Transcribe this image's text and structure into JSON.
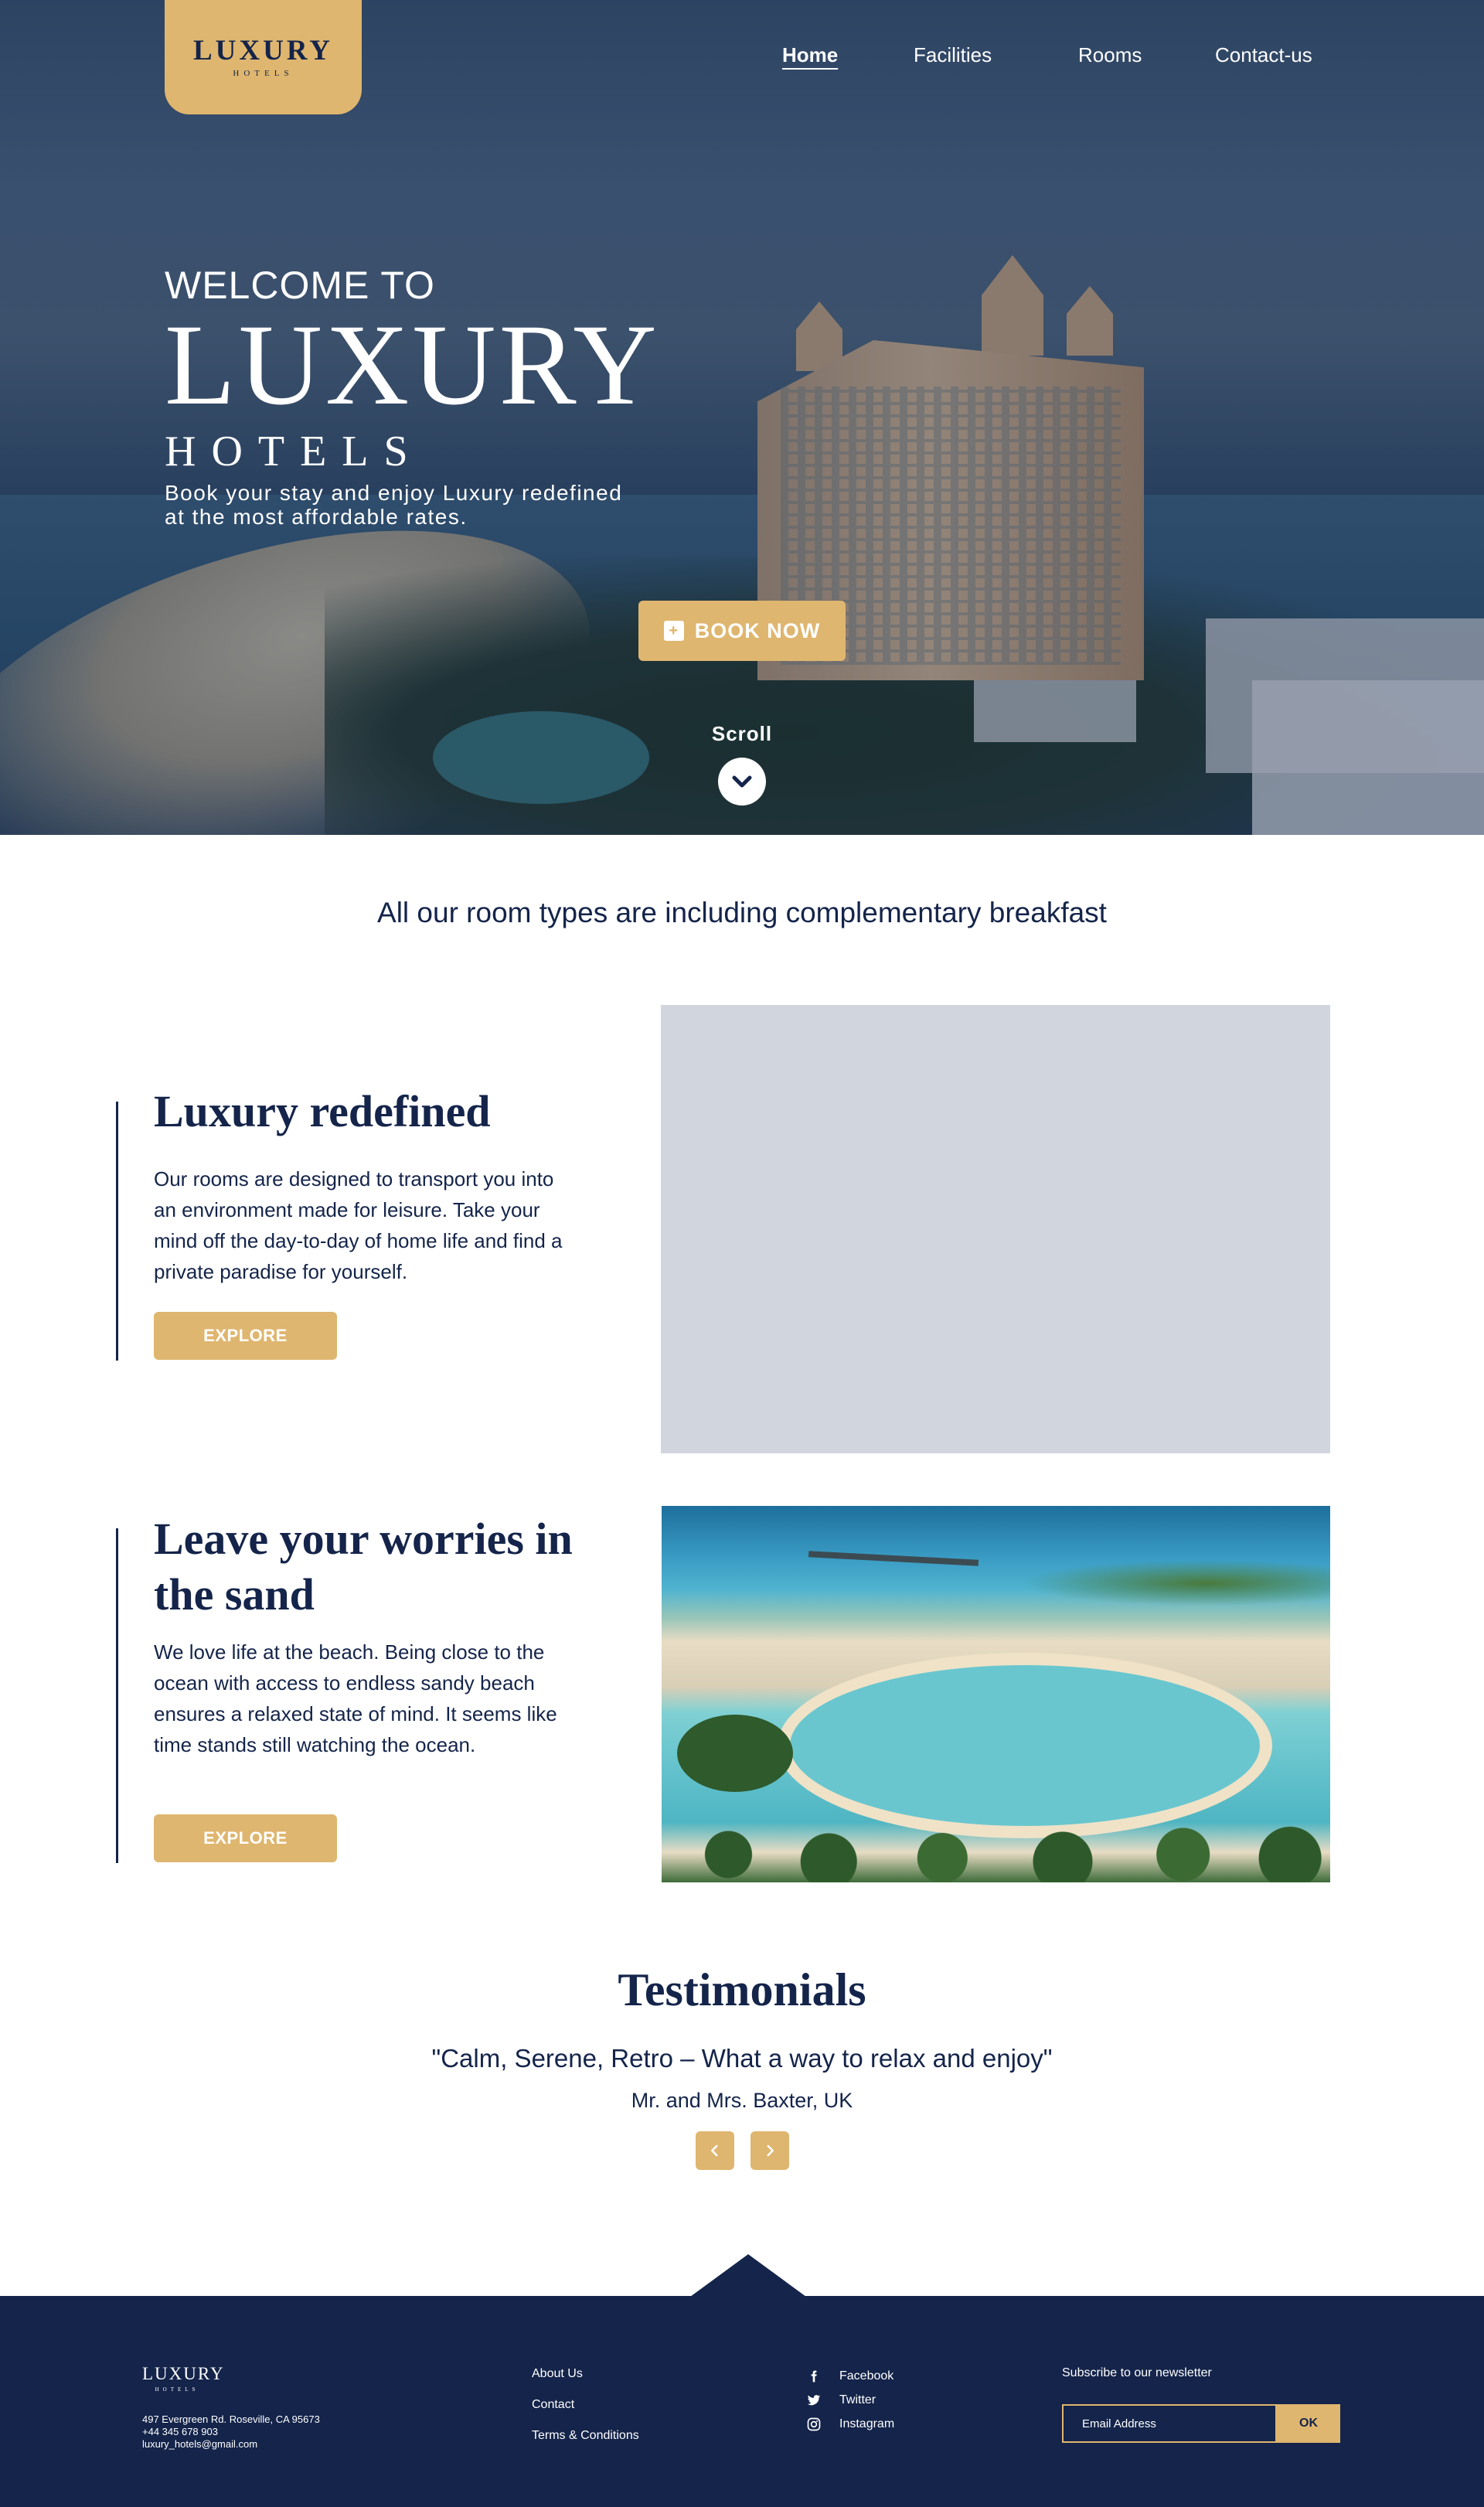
{
  "brand": {
    "name": "LUXURY",
    "sub": "HOTELS",
    "accent": "#dfb66f",
    "navy": "#14244a"
  },
  "nav": {
    "items": [
      {
        "label": "Home",
        "active": true
      },
      {
        "label": "Facilities",
        "active": false
      },
      {
        "label": "Rooms",
        "active": false
      },
      {
        "label": "Contact-us",
        "active": false
      }
    ]
  },
  "hero": {
    "welcome": "WELCOME TO",
    "title": "LUXURY",
    "subtitle": "HOTELS",
    "tagline": "Book your stay and enjoy Luxury redefined at the most affordable rates.",
    "book_label": "BOOK NOW",
    "scroll_label": "Scroll",
    "icons": {
      "book": "calendar-plus-icon",
      "scroll": "chevron-down-icon"
    }
  },
  "breakfast_note": "All our room types are including complementary breakfast",
  "features": [
    {
      "title": "Luxury redefined",
      "text": "Our rooms are designed to transport you into an environment made for leisure. Take your mind off the day-to-day of home life and find a private paradise for yourself.",
      "button": "EXPLORE"
    },
    {
      "title": "Leave your worries in the sand",
      "text": "We love life at the beach. Being close to the ocean with access to endless sandy beach ensures a relaxed state of mind. It seems like time stands still watching the ocean.",
      "button": "EXPLORE"
    }
  ],
  "testimonials": {
    "title": "Testimonials",
    "quote": "\"Calm, Serene, Retro – What a way to relax and enjoy\"",
    "author": "Mr. and Mrs. Baxter, UK",
    "icons": {
      "prev": "chevron-left-icon",
      "next": "chevron-right-icon"
    }
  },
  "footer": {
    "logo": "LUXURY",
    "logo_sub": "HOTELS",
    "address": "497 Evergreen Rd. Roseville, CA 95673",
    "phone": "+44 345 678 903",
    "email": "luxury_hotels@gmail.com",
    "links": [
      "About Us",
      "Contact",
      "Terms & Conditions"
    ],
    "social": [
      {
        "label": "Facebook",
        "icon": "facebook-icon"
      },
      {
        "label": "Twitter",
        "icon": "twitter-icon"
      },
      {
        "label": "Instagram",
        "icon": "instagram-icon"
      }
    ],
    "newsletter_title": "Subscribe to our newsletter",
    "email_placeholder": "Email Address",
    "ok_label": "OK"
  }
}
